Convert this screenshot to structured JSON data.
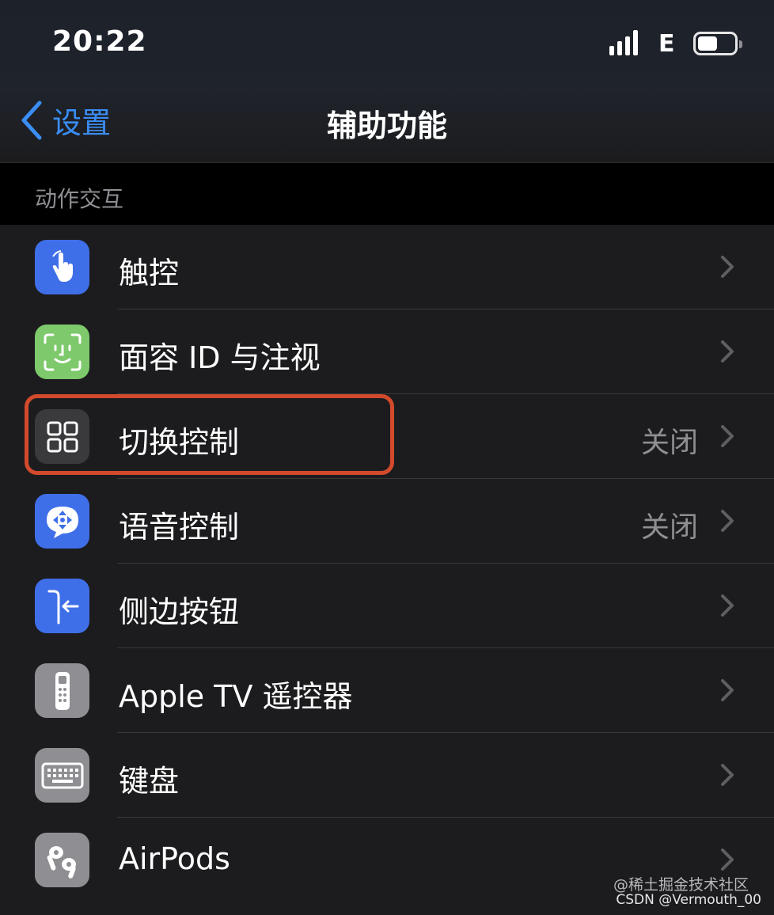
{
  "status_bar": {
    "time": "20:22",
    "network": "E",
    "battery_level": 0.55
  },
  "nav": {
    "back_label": "设置",
    "title": "辅助功能"
  },
  "section": {
    "label": "动作交互"
  },
  "rows": [
    {
      "label": "触控",
      "value": "",
      "icon": "touch-hand-icon",
      "icon_color": "#3f6fe8"
    },
    {
      "label": "面容 ID 与注视",
      "value": "",
      "icon": "face-id-icon",
      "icon_color": "#7dc96b"
    },
    {
      "label": "切换控制",
      "value": "关闭",
      "icon": "switch-control-grid-icon",
      "icon_color": "#3a3a3c"
    },
    {
      "label": "语音控制",
      "value": "关闭",
      "icon": "voice-control-icon",
      "icon_color": "#3f6fe8"
    },
    {
      "label": "侧边按钮",
      "value": "",
      "icon": "side-button-icon",
      "icon_color": "#3f6fe8"
    },
    {
      "label": "Apple TV 遥控器",
      "value": "",
      "icon": "remote-icon",
      "icon_color": "#8e8e93"
    },
    {
      "label": "键盘",
      "value": "",
      "icon": "keyboard-icon",
      "icon_color": "#8e8e93"
    },
    {
      "label": "AirPods",
      "value": "",
      "icon": "airpods-icon",
      "icon_color": "#8e8e93"
    }
  ],
  "watermark": {
    "line1": "@稀土掘金技术社区",
    "line2": "CSDN @Vermouth_00"
  },
  "colors": {
    "accent": "#3a8ef6",
    "highlight": "#d24a2c",
    "background": "#1c1c1e"
  }
}
